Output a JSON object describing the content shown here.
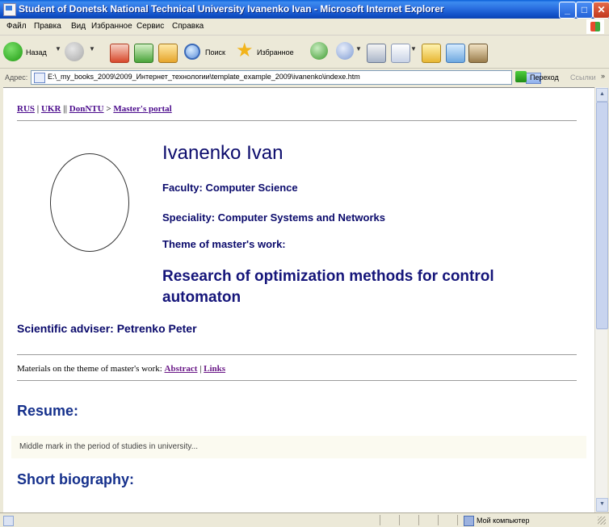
{
  "window": {
    "title": "Student of Donetsk National Technical University Ivanenko Ivan - Microsoft Internet Explorer",
    "buttons": {
      "minimize": "_",
      "maximize": "□",
      "close": "✕"
    }
  },
  "menubar": {
    "items": [
      "Файл",
      "Правка",
      "Вид",
      "Избранное",
      "Сервис",
      "Справка"
    ]
  },
  "toolbar": {
    "back_label": "Назад",
    "search_label": "Поиск",
    "favorites_label": "Избранное"
  },
  "addressbar": {
    "label": "Адрес:",
    "url": "E:\\_my_books_2009\\2009_Интернет_технологии\\template_example_2009\\ivanenko\\indexe.htm",
    "go_label": "Переход",
    "links_label": "Ссылки"
  },
  "page": {
    "breadcrumb": {
      "rus": "RUS",
      "sep1": " | ",
      "ukr": "UKR",
      "sep2": " || ",
      "donntu": "DonNTU",
      "arrow": " > ",
      "portal": "Master's portal"
    },
    "name": "Ivanenko Ivan",
    "faculty": "Faculty: Computer Science",
    "speciality": "Speciality: Computer Systems and Networks",
    "theme_label": "Theme of master's work:",
    "theme": "Research of optimization methods for control automaton",
    "adviser": "Scientific adviser: Petrenko Peter",
    "materials": {
      "label": "Materials on the theme of master's work: ",
      "abstract": "Abstract",
      "sep": " | ",
      "links": "Links"
    },
    "resume_title": "Resume:",
    "resume_text": "Middle mark in the period of studies in university...",
    "biography_title": "Short biography:"
  },
  "statusbar": {
    "zone": "Мой компьютер"
  },
  "colors": {
    "title_bar": "#0b43b3",
    "heading": "#0b0b6c",
    "section": "#15308c",
    "link": "#4b0b8c"
  },
  "icons": [
    "app-icon",
    "back-icon",
    "forward-icon",
    "stop-icon",
    "refresh-icon",
    "home-icon",
    "search-icon",
    "favorites-icon",
    "media-icon",
    "mail-icon",
    "print-icon",
    "edit-icon",
    "folder-icon",
    "messenger-icon",
    "research-icon",
    "page-icon",
    "go-icon",
    "windows-logo-icon",
    "computer-icon"
  ]
}
